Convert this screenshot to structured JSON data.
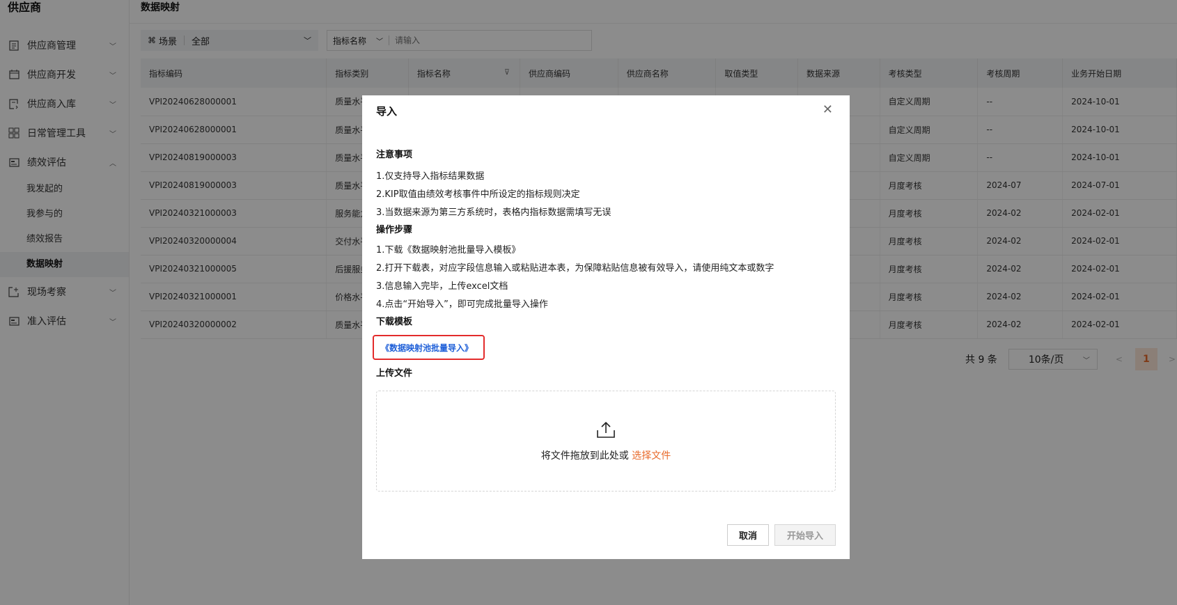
{
  "sidebar": {
    "brand": "供应商",
    "items": [
      {
        "label": "供应商管理",
        "icon": "document-list-icon",
        "chevron": "﹀"
      },
      {
        "label": "供应商开发",
        "icon": "calendar-icon",
        "chevron": "﹀"
      },
      {
        "label": "供应商入库",
        "icon": "inbound-icon",
        "chevron": "﹀"
      },
      {
        "label": "日常管理工具",
        "icon": "grid-icon",
        "chevron": "﹀"
      },
      {
        "label": "绩效评估",
        "icon": "chart-card-icon",
        "chevron": "︿"
      },
      {
        "label": "现场考察",
        "icon": "site-icon",
        "chevron": "﹀"
      },
      {
        "label": "准入评估",
        "icon": "assessment-icon",
        "chevron": "﹀"
      }
    ],
    "sub_items": [
      "我发起的",
      "我参与的",
      "绩效报告",
      "数据映射"
    ]
  },
  "page": {
    "title": "数据映射"
  },
  "filters": {
    "scene_label": "场景",
    "scene_value": "全部",
    "field_label": "指标名称",
    "search_placeholder": "请输入"
  },
  "table": {
    "columns": [
      "指标编码",
      "指标类别",
      "指标名称",
      "供应商编码",
      "供应商名称",
      "取值类型",
      "数据来源",
      "考核类型",
      "考核周期",
      "业务开始日期"
    ],
    "rows": [
      [
        "VPI20240628000001",
        "质量水平",
        "",
        "",
        "",
        "",
        "",
        "自定义周期",
        "--",
        "2024-10-01"
      ],
      [
        "VPI20240628000001",
        "质量水平",
        "",
        "",
        "",
        "",
        "",
        "自定义周期",
        "--",
        "2024-10-01"
      ],
      [
        "VPI20240819000003",
        "质量水平",
        "",
        "",
        "",
        "",
        "",
        "自定义周期",
        "--",
        "2024-10-01"
      ],
      [
        "VPI20240819000003",
        "质量水平",
        "",
        "",
        "",
        "",
        "",
        "月度考核",
        "2024-07",
        "2024-07-01"
      ],
      [
        "VPI20240321000003",
        "服务能力",
        "",
        "",
        "",
        "",
        "",
        "月度考核",
        "2024-02",
        "2024-02-01"
      ],
      [
        "VPI20240320000004",
        "交付水平",
        "",
        "",
        "",
        "",
        "",
        "月度考核",
        "2024-02",
        "2024-02-01"
      ],
      [
        "VPI20240321000005",
        "后援服务",
        "",
        "",
        "",
        "",
        "",
        "月度考核",
        "2024-02",
        "2024-02-01"
      ],
      [
        "VPI20240321000001",
        "价格水平",
        "",
        "",
        "",
        "",
        "",
        "月度考核",
        "2024-02",
        "2024-02-01"
      ],
      [
        "VPI20240320000002",
        "质量水平",
        "",
        "",
        "",
        "",
        "",
        "月度考核",
        "2024-02",
        "2024-02-01"
      ]
    ]
  },
  "pagination": {
    "total": "共 9 条",
    "page_size": "10条/页",
    "current_page": "1"
  },
  "modal": {
    "title": "导入",
    "notice_title": "注意事项",
    "notices": [
      "1.仅支持导入指标结果数据",
      "2.KIP取值由绩效考核事件中所设定的指标规则决定",
      "3.当数据来源为第三方系统时，表格内指标数据需填写无误"
    ],
    "steps_title": "操作步骤",
    "steps": [
      "1.下载《数据映射池批量导入模板》",
      "2.打开下载表，对应字段信息输入或粘贴进本表，为保障粘贴信息被有效导入，请使用纯文本或数字",
      "3.信息输入完毕，上传excel文档",
      "4.点击“开始导入”，即可完成批量导入操作"
    ],
    "download_title": "下载模板",
    "download_link": "《数据映射池批量导入》",
    "upload_title": "上传文件",
    "upload_hint": "将文件拖放到此处或",
    "upload_choose": "选择文件",
    "cancel_label": "取消",
    "start_label": "开始导入"
  },
  "colors": {
    "accent": "#e86a2b",
    "link": "#1e5fd8",
    "highlight_border": "#e32b2b"
  }
}
